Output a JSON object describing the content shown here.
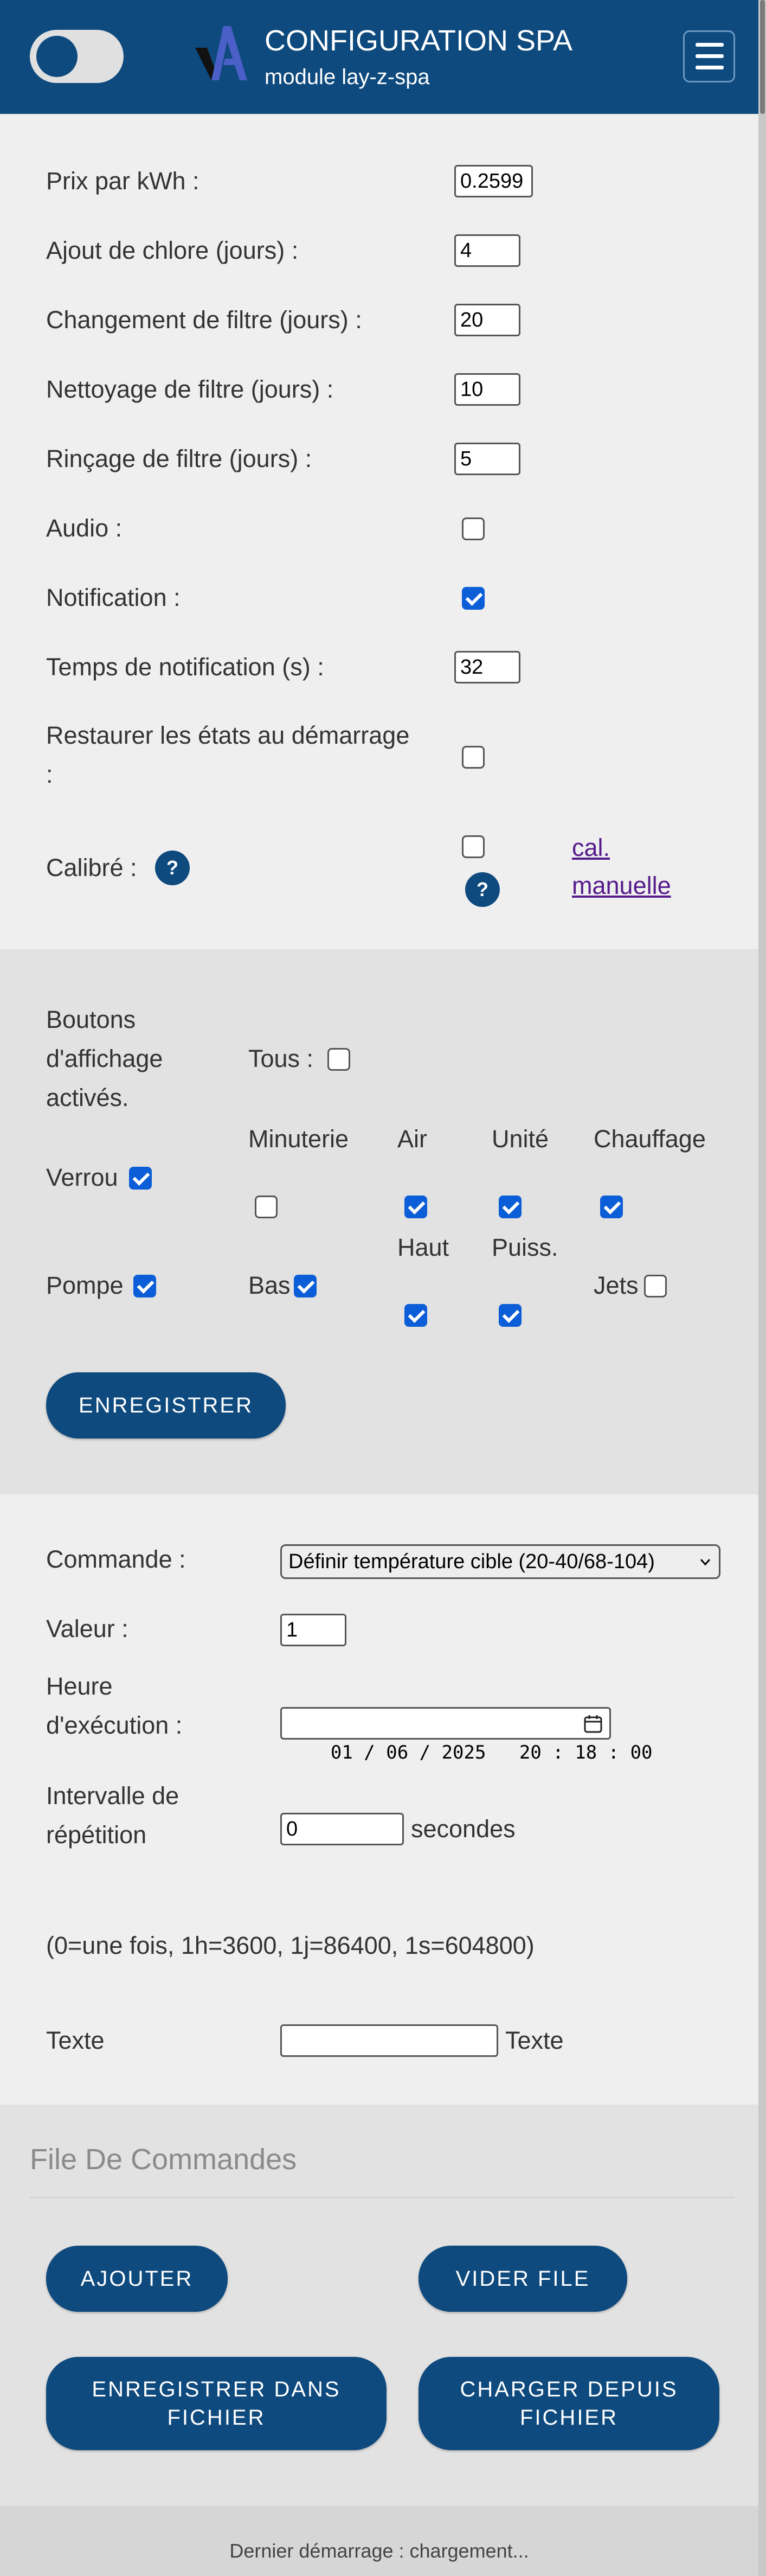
{
  "header": {
    "title": "CONFIGURATION SPA",
    "subtitle": "module lay-z-spa",
    "colors": {
      "primary": "#0e4a7e",
      "accent": "#0b5ed7",
      "link": "#551a8b"
    }
  },
  "settings": {
    "price_label": "Prix par kWh :",
    "price_value": "0.2599",
    "chlorine_label": "Ajout de chlore (jours) :",
    "chlorine_value": "4",
    "filter_change_label": "Changement de filtre (jours) :",
    "filter_change_value": "20",
    "filter_clean_label": "Nettoyage de filtre (jours) :",
    "filter_clean_value": "10",
    "filter_rinse_label": "Rinçage de filtre (jours) :",
    "filter_rinse_value": "5",
    "audio_label": "Audio :",
    "audio_checked": false,
    "notification_label": "Notification :",
    "notification_checked": true,
    "notif_time_label": "Temps de notification (s) :",
    "notif_time_value": "32",
    "restore_label_1": "Restaurer les états au démarrage",
    "restore_label_2": ":",
    "restore_checked": false,
    "calibrated_label": "Calibré :",
    "calibrated_checked": false,
    "help_glyph": "?",
    "manual_cal_link_1": "cal.",
    "manual_cal_link_2": "manuelle"
  },
  "display_buttons": {
    "heading_lines": [
      "Boutons",
      "d'affichage",
      "activés."
    ],
    "all_label": "Tous :",
    "all_checked": false,
    "items": [
      {
        "label": "Verrou",
        "checked": true
      },
      {
        "label": "Minuterie",
        "checked": false
      },
      {
        "label": "Air",
        "checked": true
      },
      {
        "label": "Unité",
        "checked": true
      },
      {
        "label": "Chauffage",
        "checked": true
      },
      {
        "label": "Pompe",
        "checked": true
      },
      {
        "label": "Bas",
        "checked": true
      },
      {
        "label": "Haut",
        "checked": true
      },
      {
        "label": "Puiss.",
        "checked": true
      },
      {
        "label": "Jets",
        "checked": false
      }
    ],
    "save_button": "ENREGISTRER"
  },
  "command": {
    "command_label": "Commande :",
    "command_value": "Définir température cible (20-40/68-104)",
    "value_label": "Valeur :",
    "value_value": "1",
    "exec_time_label_1": "Heure",
    "exec_time_label_2": "d'exécution :",
    "exec_time_value": "01 / 06 / 2025   20 : 18 : 00",
    "repeat_label_1": "Intervalle de",
    "repeat_label_2": "répétition",
    "repeat_value": "0",
    "repeat_unit": "secondes",
    "repeat_hint": "(0=une fois, 1h=3600, 1j=86400, 1s=604800)",
    "text_label": "Texte",
    "text_value": "",
    "text_suffix": "Texte"
  },
  "queue": {
    "title": "File De Commandes",
    "add_button": "AJOUTER",
    "clear_button": "VIDER FILE",
    "save_file_button_1": "ENREGISTRER DANS",
    "save_file_button_2": "FICHIER",
    "load_file_button_1": "CHARGER DEPUIS",
    "load_file_button_2": "FICHIER"
  },
  "footer": {
    "text": "Dernier démarrage : chargement..."
  }
}
